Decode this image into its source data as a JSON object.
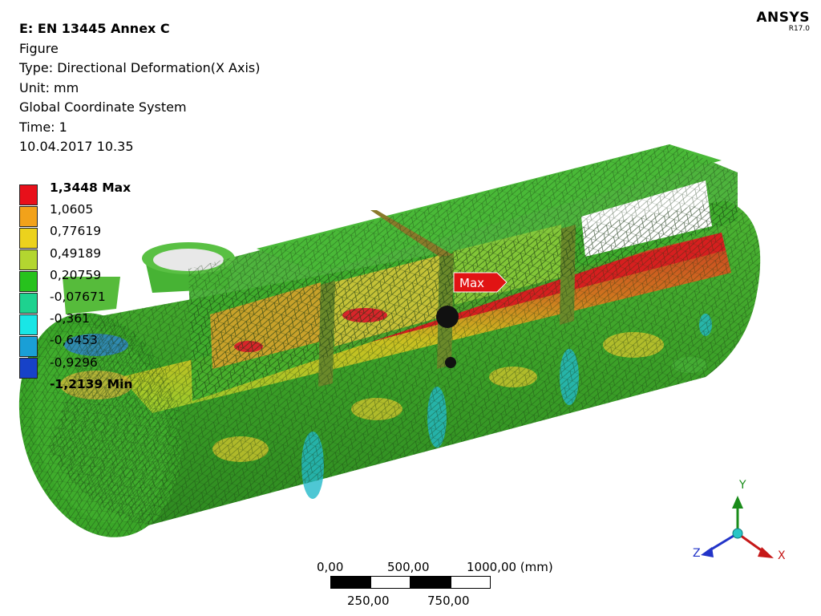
{
  "header": {
    "title": "E: EN 13445 Annex C",
    "lines": [
      "Figure",
      "Type: Directional Deformation(X Axis)",
      "Unit: mm",
      "Global Coordinate System",
      "Time: 1",
      "10.04.2017 10.35"
    ]
  },
  "brand": {
    "name": "ANSYS",
    "version": "R17.0"
  },
  "legend": {
    "labels": [
      "1,3448 Max",
      "1,0605",
      "0,77619",
      "0,49189",
      "0,20759",
      "-0,07671",
      "-0,361",
      "-0,6453",
      "-0,9296",
      "-1,2139 Min"
    ],
    "colors": [
      "#e8101a",
      "#f2a21a",
      "#ecd21d",
      "#b3d630",
      "#27c21d",
      "#1ed28f",
      "#19e6e6",
      "#1a9fd6",
      "#1742c8"
    ]
  },
  "probe": {
    "label": "Max"
  },
  "scale": {
    "top_labels": [
      "0,00",
      "500,00",
      "1000,00 (mm)"
    ],
    "bottom_labels": [
      "250,00",
      "750,00"
    ]
  },
  "triad": {
    "x": "X",
    "y": "Y",
    "z": "Z"
  },
  "colors": {
    "mesh": "#1c3a12",
    "shell_base": "#3daa2a",
    "max_red": "#d61f1f"
  }
}
